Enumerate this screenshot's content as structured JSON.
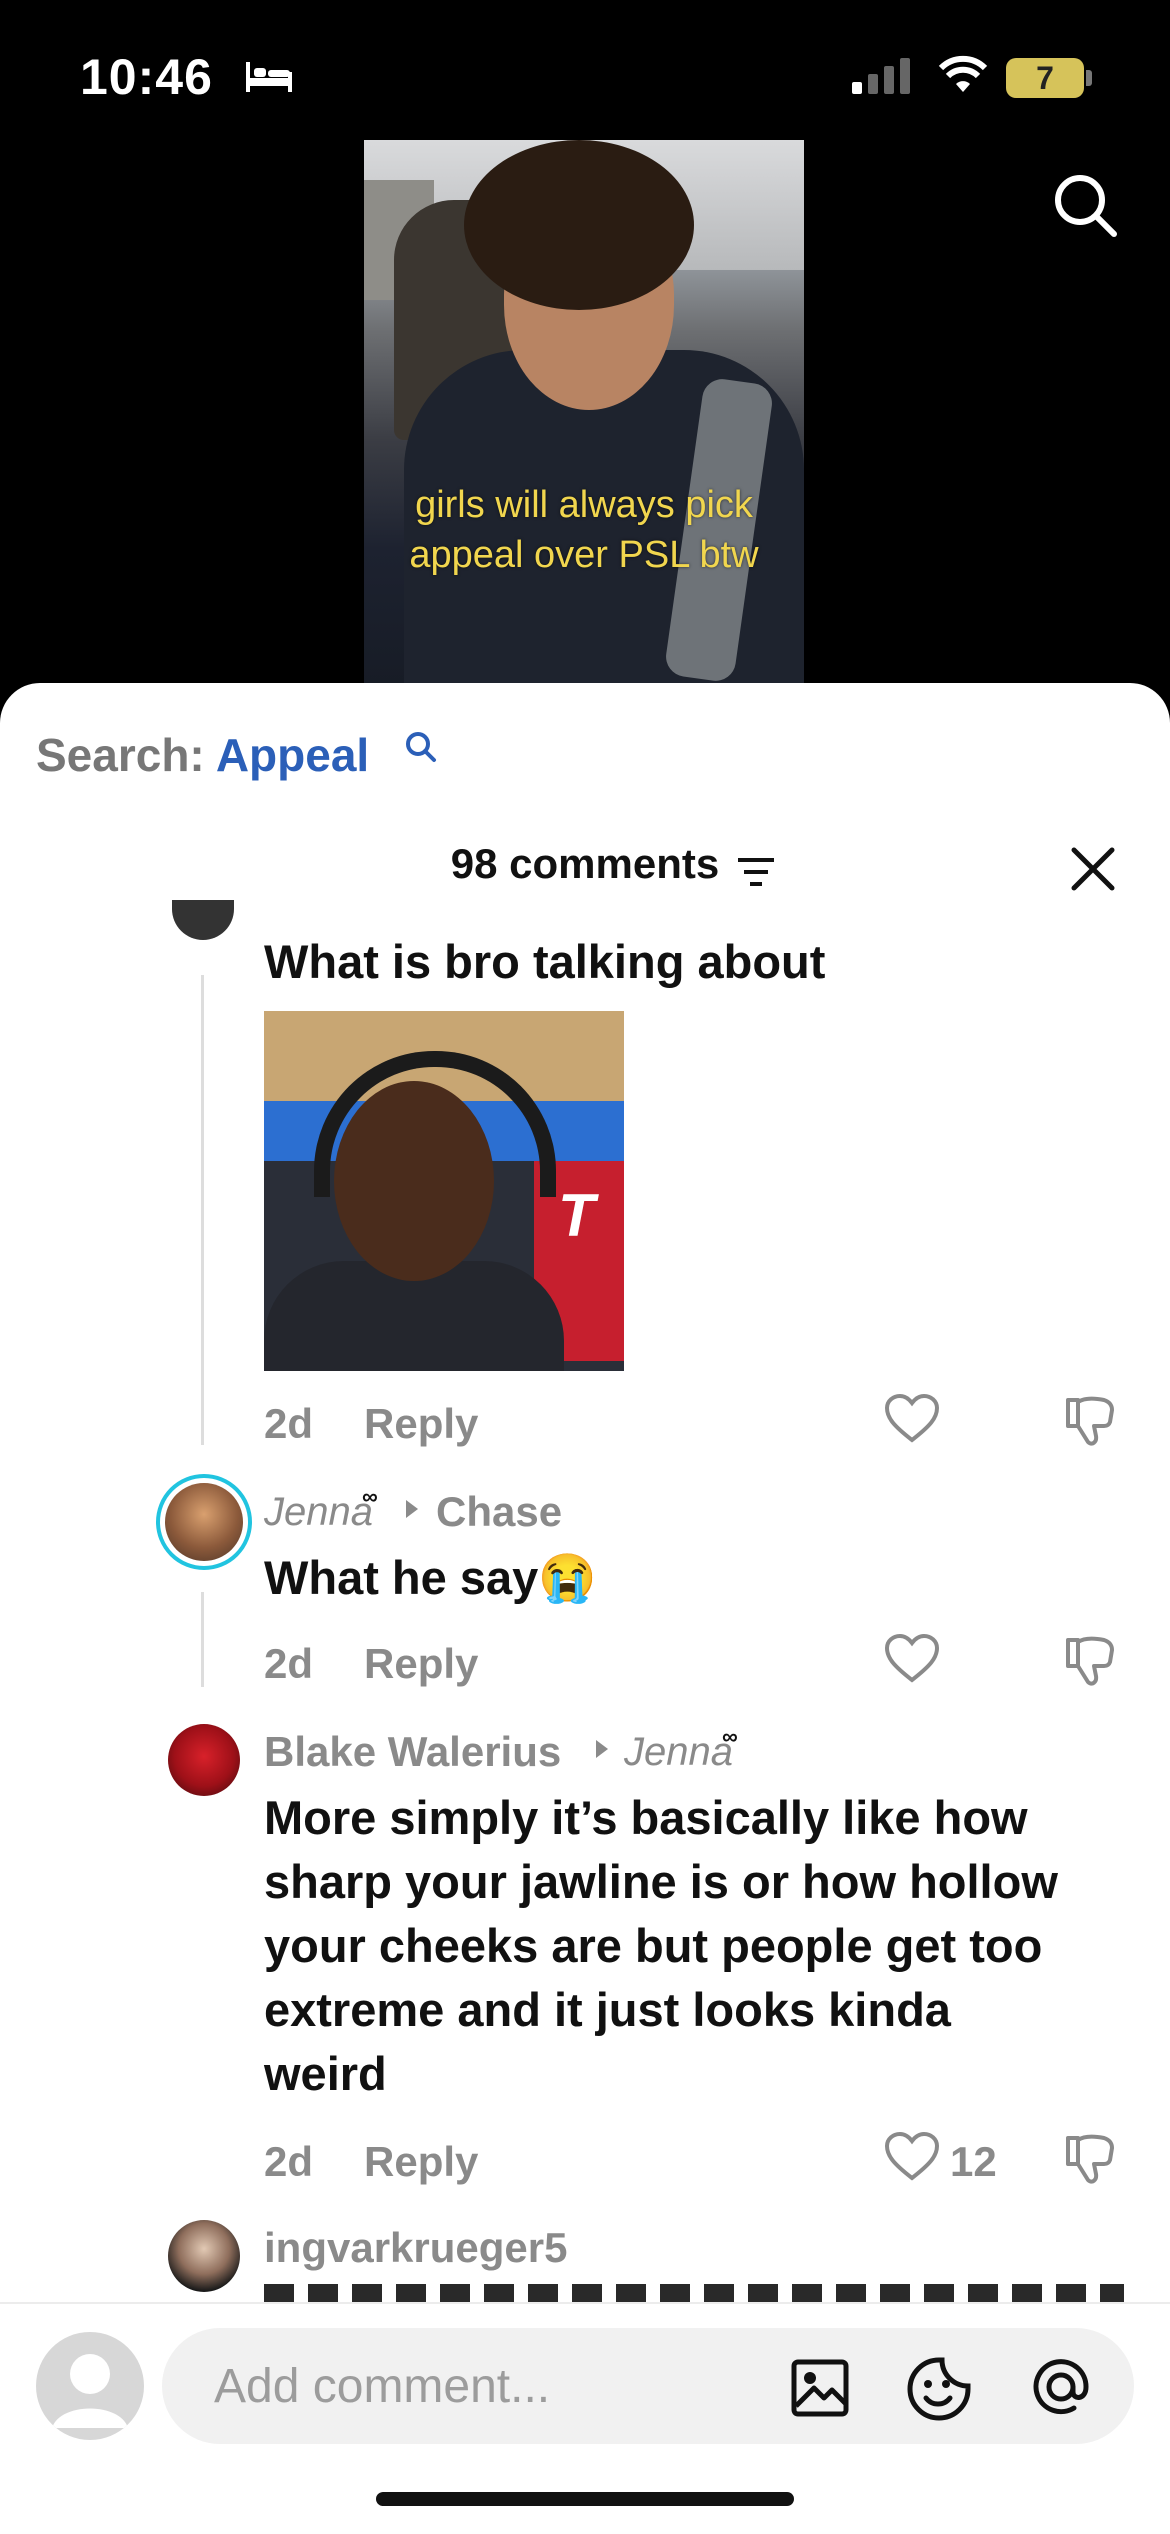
{
  "status_bar": {
    "time": "10:46",
    "battery": "7"
  },
  "video": {
    "caption_line1": "girls will always pick",
    "caption_line2": "appeal over PSL btw"
  },
  "search": {
    "label": "Search:",
    "term": "Appeal"
  },
  "comments_header": {
    "count_label": "98 comments"
  },
  "comments": [
    {
      "text": "What is bro talking about",
      "has_gif": true,
      "time": "2d",
      "reply_label": "Reply"
    },
    {
      "author": "Jenna",
      "reply_to": "Chase",
      "text": "What he say",
      "emoji": "😭",
      "time": "2d",
      "reply_label": "Reply"
    },
    {
      "author": "Blake Walerius",
      "reply_to": "Jenna",
      "text_lines": [
        "More simply it’s basically like how",
        "sharp your jawline is or how hollow",
        "your cheeks are but people get too",
        "extreme and it just looks kinda",
        "weird"
      ],
      "time": "2d",
      "reply_label": "Reply",
      "likes": "12"
    },
    {
      "author": "ingvarkrueger5"
    }
  ],
  "composer": {
    "placeholder": "Add comment..."
  },
  "colors": {
    "search_term": "#2b5fb8",
    "caption": "#f1d64e",
    "story_ring": "#21c4e0"
  }
}
